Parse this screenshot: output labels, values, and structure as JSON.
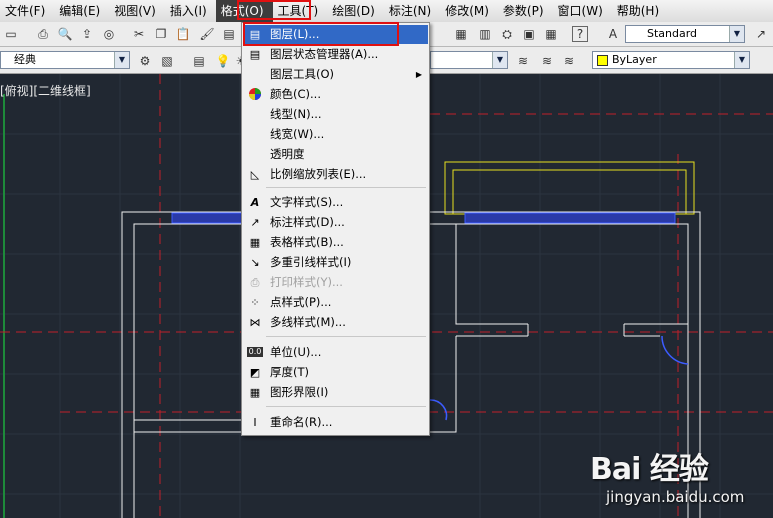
{
  "menubar": {
    "items": [
      {
        "label": "文件(F)"
      },
      {
        "label": "编辑(E)"
      },
      {
        "label": "视图(V)"
      },
      {
        "label": "插入(I)"
      },
      {
        "label": "格式(O)"
      },
      {
        "label": "工具(T)"
      },
      {
        "label": "绘图(D)"
      },
      {
        "label": "标注(N)"
      },
      {
        "label": "修改(M)"
      },
      {
        "label": "参数(P)"
      },
      {
        "label": "窗口(W)"
      },
      {
        "label": "帮助(H)"
      }
    ]
  },
  "toolbar": {
    "text_style": "Standard"
  },
  "toolbar2": {
    "workspace": "经典",
    "layer_color": "ByLayer",
    "layer_color_swatch": "#ffff00"
  },
  "viewport": {
    "label": "[俯视][二维线框]"
  },
  "format_menu": {
    "items": [
      {
        "label": "图层(L)...",
        "icon": "layer-icon"
      },
      {
        "label": "图层状态管理器(A)...",
        "icon": "layer-state-icon"
      },
      {
        "label": "图层工具(O)",
        "icon": ""
      },
      {
        "label": "颜色(C)...",
        "icon": "color-wheel-icon"
      },
      {
        "label": "线型(N)...",
        "icon": ""
      },
      {
        "label": "线宽(W)...",
        "icon": ""
      },
      {
        "label": "透明度",
        "icon": ""
      },
      {
        "label": "比例缩放列表(E)...",
        "icon": "scale-list-icon"
      },
      {
        "label": "文字样式(S)...",
        "icon": "text-style-icon"
      },
      {
        "label": "标注样式(D)...",
        "icon": "dim-style-icon"
      },
      {
        "label": "表格样式(B)...",
        "icon": "table-style-icon"
      },
      {
        "label": "多重引线样式(I)",
        "icon": "mleader-style-icon"
      },
      {
        "label": "打印样式(Y)...",
        "icon": "plot-style-icon"
      },
      {
        "label": "点样式(P)...",
        "icon": "point-style-icon"
      },
      {
        "label": "多线样式(M)...",
        "icon": "mline-style-icon"
      },
      {
        "label": "单位(U)...",
        "icon": "units-icon"
      },
      {
        "label": "厚度(T)",
        "icon": "thickness-icon"
      },
      {
        "label": "图形界限(I)",
        "icon": "limits-icon"
      },
      {
        "label": "重命名(R)...",
        "icon": "rename-icon"
      }
    ]
  },
  "watermark": {
    "logo": "Bai 经验",
    "url": "jingyan.baidu.com"
  }
}
